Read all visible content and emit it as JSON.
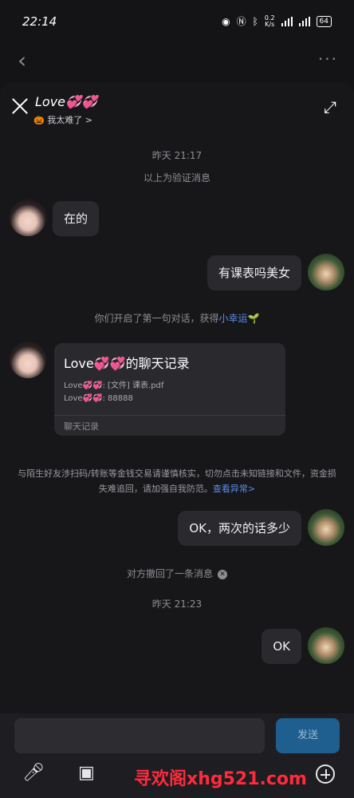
{
  "status_bar": {
    "time": "22:14",
    "speed_top": "0.2",
    "speed_bottom": "K/s",
    "battery": "64"
  },
  "chat": {
    "contact_name": "Love💞💞",
    "contact_status": "🎃 我太难了 >",
    "timestamp_1": "昨天 21:17",
    "system_verify": "以上为验证消息",
    "msg_1": "在的",
    "msg_2": "有课表吗美女",
    "first_chat_prefix": "你们开启了第一句对话，获得",
    "first_chat_link": "小幸运",
    "first_chat_suffix": "🌱",
    "record_title": "Love💞💞的聊天记录",
    "record_line_1": "Love💞💞: [文件] 课表.pdf",
    "record_line_2": "Love💞💞: 88888",
    "record_footer": "聊天记录",
    "warning_text": "与陌生好友涉扫码/转账等金钱交易请谨慎核实，切勿点击未知链接和文件，资金损失难追回，请加强自我防范。",
    "warning_link": "查看异常>",
    "msg_3": "OK，两次的话多少",
    "recall_text": "对方撤回了一条消息",
    "timestamp_2": "昨天 21:23",
    "msg_4": "OK"
  },
  "input": {
    "send_label": "发送",
    "watermark": "寻欢阁xhg521.com"
  }
}
